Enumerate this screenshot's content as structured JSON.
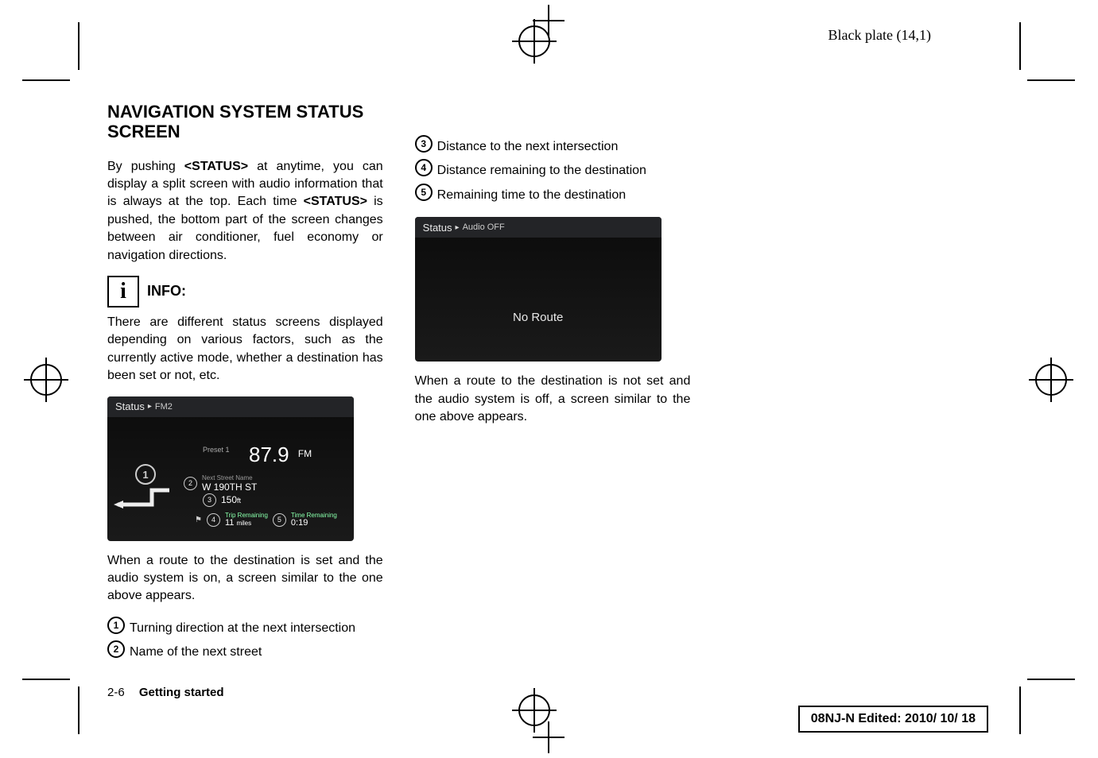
{
  "plate_info": "Black plate (14,1)",
  "heading": "NAVIGATION SYSTEM STATUS SCREEN",
  "intro_html": "By pushing <b>&lt;STATUS&gt;</b> at anytime, you can display a split screen with audio information that is always at the top. Each time <b>&lt;STATUS&gt;</b> is pushed, the bottom part of the screen changes between air conditioner, fuel economy or navigation directions.",
  "info_label": "INFO:",
  "info_text": "There are different status screens displayed depending on various factors, such as the currently active mode, whether a destination has been set or not, etc.",
  "screen1": {
    "status_label": "Status",
    "status_sub": "FM2",
    "preset_label": "Preset 1",
    "freq": "87.9",
    "band": "FM",
    "next_street_label": "Next Street Name",
    "street": "W 190TH ST",
    "dist_value": "150",
    "dist_unit": "ft",
    "trip_label": "Trip Remaining",
    "trip_value": "11",
    "trip_unit": "miles",
    "time_label": "Time Remaining",
    "time_value": "0:19"
  },
  "screen1_caption": "When a route to the destination is set and the audio system is on, a screen similar to the one above appears.",
  "legend_col1": [
    {
      "n": "1",
      "t": "Turning direction at the next intersection"
    },
    {
      "n": "2",
      "t": "Name of the next street"
    }
  ],
  "legend_col2": [
    {
      "n": "3",
      "t": "Distance to the next intersection"
    },
    {
      "n": "4",
      "t": "Distance remaining to the destination"
    },
    {
      "n": "5",
      "t": "Remaining time to the destination"
    }
  ],
  "screen2": {
    "status_label": "Status",
    "status_sub": "Audio OFF",
    "no_route": "No Route"
  },
  "screen2_caption": "When a route to the destination is not set and the audio system is off, a screen similar to the one above appears.",
  "footer": {
    "page_num": "2-6",
    "section": "Getting started"
  },
  "edit_stamp": "08NJ-N Edited:  2010/ 10/ 18"
}
